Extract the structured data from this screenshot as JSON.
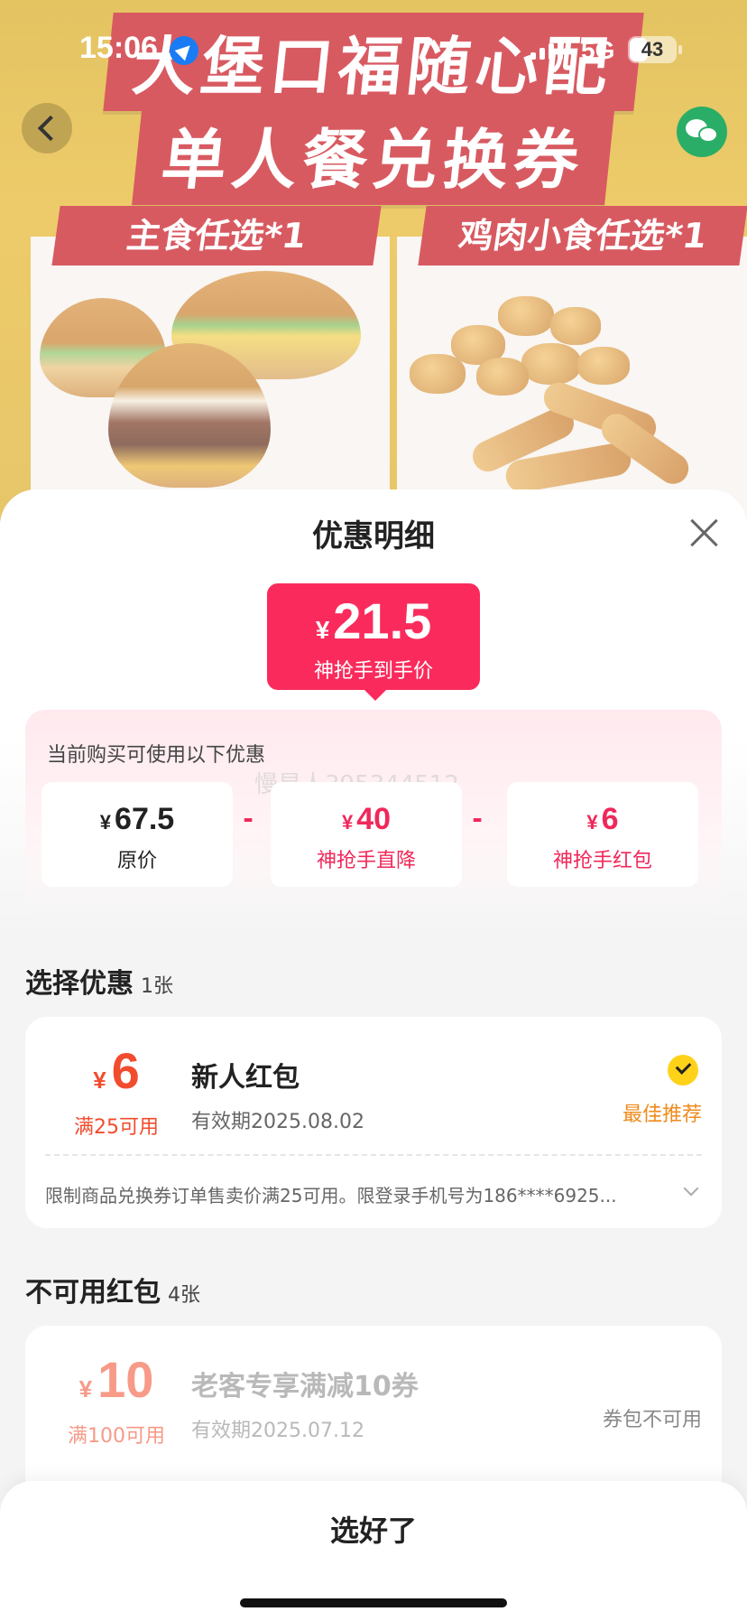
{
  "status_bar": {
    "time": "15:06",
    "network": "5G",
    "battery": "43"
  },
  "banner": {
    "title_line1": "大堡口福随心配",
    "title_line2": "单人餐兑换券",
    "tag_left": "主食任选*1",
    "tag_right": "鸡肉小食任选*1"
  },
  "sheet": {
    "title": "优惠明细",
    "final_price": {
      "currency": "¥",
      "amount": "21.5",
      "label": "神抢手到手价"
    },
    "breakdown": {
      "hint": "当前购买可使用以下优惠",
      "watermark": "慢星人395344512",
      "items": [
        {
          "currency": "¥",
          "value": "67.5",
          "label": "原价"
        },
        {
          "currency": "¥",
          "value": "40",
          "label": "神抢手直降"
        },
        {
          "currency": "¥",
          "value": "6",
          "label": "神抢手红包"
        }
      ],
      "operator": "-"
    },
    "select_section": {
      "title": "选择优惠",
      "count": "1张"
    },
    "selected_coupon": {
      "currency": "¥",
      "value": "6",
      "condition": "满25可用",
      "name": "新人红包",
      "expiry": "有效期2025.08.02",
      "badge": "最佳推荐",
      "rule": "限制商品兑换券订单售卖价满25可用。限登录手机号为186****6925..."
    },
    "unavailable_section": {
      "title": "不可用红包",
      "count": "4张"
    },
    "unavailable_coupons": [
      {
        "currency": "¥",
        "value": "10",
        "condition": "满100可用",
        "name": "老客专享满减10券",
        "expiry": "有效期2025.07.12",
        "status": "券包不可用"
      }
    ],
    "confirm_label": "选好了"
  },
  "colors": {
    "accent": "#fa2b5c",
    "coupon_red": "#f24c2e",
    "best_orange": "#f08a1c",
    "check_yellow": "#ffd21a"
  }
}
